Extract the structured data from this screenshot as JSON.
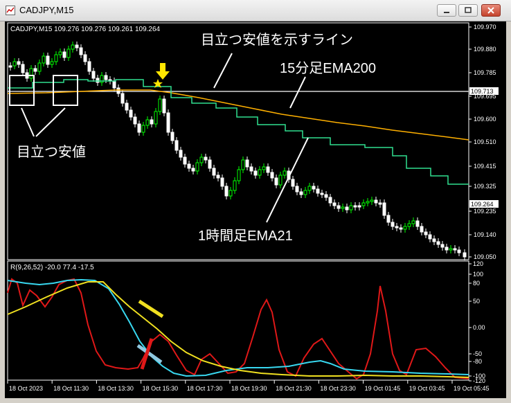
{
  "window": {
    "title": "CADJPY,M15",
    "buttons": [
      "minimize",
      "maximize",
      "close"
    ]
  },
  "main_chart": {
    "header": "CADJPY,M15  109.276 109.276 109.261 109.264",
    "price_axis": [
      "109.970",
      "109.880",
      "109.785",
      "109.695",
      "109.600",
      "109.510",
      "109.415",
      "109.325",
      "109.235",
      "109.140",
      "109.050"
    ],
    "price_tags": {
      "line": "109.713",
      "current": "109.264"
    },
    "annotations": {
      "line_label": "目立つ安値を示すライン",
      "ema200_label": "15分足EMA200",
      "ema21_label": "1時間足EMA21",
      "lows_label": "目立つ安値"
    },
    "colors": {
      "bull_candle": "#00ff00",
      "bear_candle": "#ffffff",
      "ema200": "#ffb000",
      "ema21": "#30e090",
      "support_line": "#ffffff",
      "arrow": "#ffe600",
      "annotation": "#ffffff"
    }
  },
  "sub_chart": {
    "header": "R(9,26,52) -20.0 77.4 -17.5",
    "axis": [
      "120",
      "100",
      "80",
      "50",
      "0.00",
      "-50",
      "-80",
      "-100",
      "-120"
    ],
    "colors": {
      "fast": "#e01818",
      "mid": "#38d8f0",
      "slow": "#f0e020",
      "mark_yellow": "#f0e020",
      "mark_red": "#e01818",
      "mark_blue": "#90c8e0"
    }
  },
  "time_axis": [
    "18 Oct 2023",
    "18 Oct 11:30",
    "18 Oct 13:30",
    "18 Oct 15:30",
    "18 Oct 17:30",
    "18 Oct 19:30",
    "18 Oct 21:30",
    "18 Oct 23:30",
    "19 Oct 01:45",
    "19 Oct 03:45",
    "19 Oct 05:45"
  ],
  "chart_data": {
    "type": "line",
    "symbol": "CADJPY",
    "timeframe": "M15",
    "ohlc_last": {
      "open": 109.276,
      "high": 109.276,
      "low": 109.261,
      "close": 109.264
    },
    "ylim": [
      109.05,
      109.97
    ],
    "horizontal_line": 109.713,
    "series": [
      {
        "name": "15分足EMA200",
        "values": [
          109.71,
          109.71,
          109.715,
          109.72,
          109.72,
          109.715,
          109.71,
          109.7,
          109.685,
          109.665,
          109.645,
          109.625,
          109.605,
          109.585,
          109.565,
          109.545,
          109.53,
          109.515
        ]
      },
      {
        "name": "1時間足EMA21",
        "values": [
          109.73,
          109.75,
          109.75,
          109.74,
          109.74,
          109.745,
          109.74,
          109.69,
          109.66,
          109.615,
          109.58,
          109.535,
          109.515,
          109.48,
          109.455,
          109.425,
          109.395,
          109.345
        ]
      }
    ],
    "indicator": {
      "name": "R(9,26,52)",
      "values_last": [
        -20.0,
        77.4,
        -17.5
      ],
      "ylim": [
        -120,
        120
      ]
    }
  }
}
